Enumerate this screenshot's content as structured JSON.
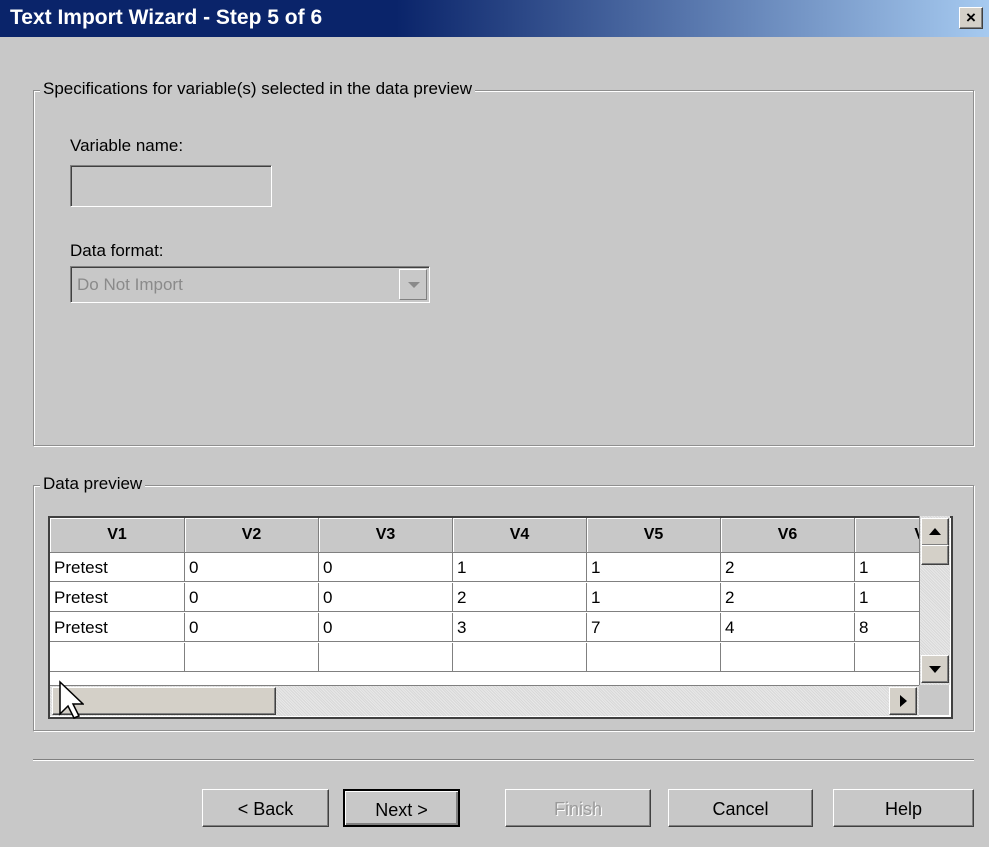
{
  "window": {
    "title": "Text Import Wizard - Step 5 of 6",
    "close_label": "×"
  },
  "specs": {
    "legend": "Specifications for variable(s) selected in the data preview",
    "variable_name_label": "Variable name:",
    "variable_name_value": "",
    "data_format_label": "Data format:",
    "data_format_value": "Do Not Import"
  },
  "preview": {
    "legend": "Data preview",
    "columns": [
      "V1",
      "V2",
      "V3",
      "V4",
      "V5",
      "V6",
      "V"
    ],
    "rows": [
      [
        "Pretest",
        "0",
        "0",
        "1",
        "1",
        "2",
        "1"
      ],
      [
        "Pretest",
        "0",
        "0",
        "2",
        "1",
        "2",
        "1"
      ],
      [
        "Pretest",
        "0",
        "0",
        "3",
        "7",
        "4",
        "8"
      ],
      [
        "",
        "",
        "",
        "",
        "",
        "",
        ""
      ]
    ]
  },
  "buttons": {
    "back": "< Back",
    "next": "Next >",
    "finish": "Finish",
    "cancel": "Cancel",
    "help": "Help"
  }
}
